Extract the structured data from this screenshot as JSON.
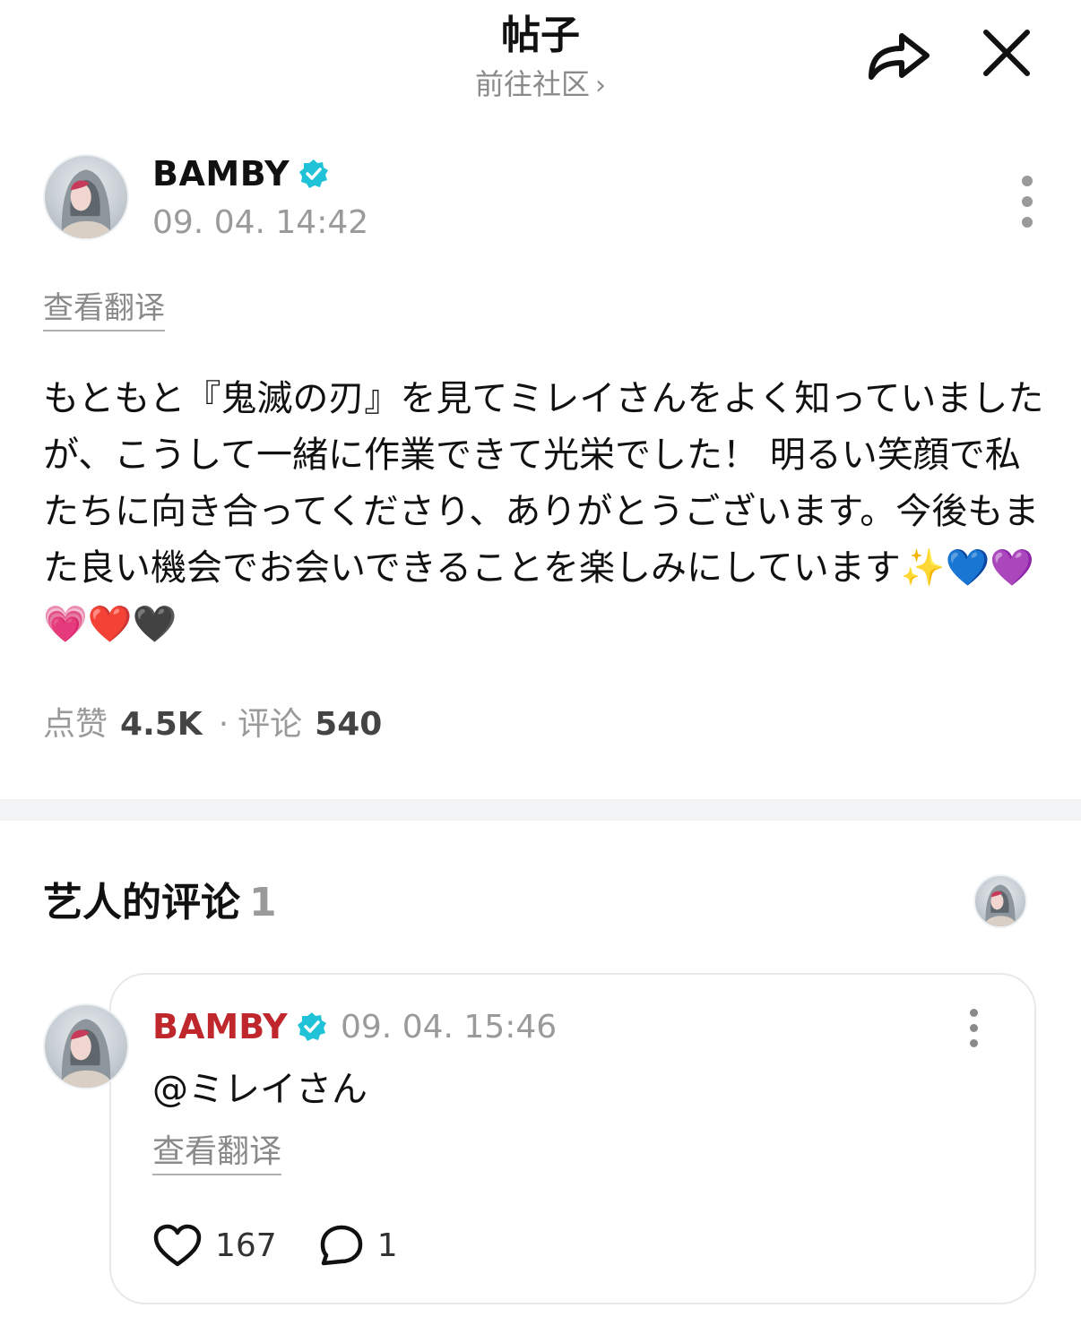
{
  "header": {
    "title": "帖子",
    "community_link": "前往社区",
    "share_icon": "share-icon",
    "close_icon": "close-icon"
  },
  "post": {
    "author": "BAMBY",
    "verified_icon": "verified-badge-icon",
    "timestamp": "09. 04. 14:42",
    "translate_label": "查看翻译",
    "body": "もともと『鬼滅の刃』を見てミレイさんをよく知っていましたが、こうして一緒に作業できて光栄でした！ 明るい笑顔で私たちに向き合ってくださり、ありがとうございます。今後もまた良い機会でお会いできることを楽しみにしています✨💙💜💗❤️🖤",
    "likes_label": "点赞",
    "likes_value": "4.5K",
    "comments_label": "评论",
    "comments_value": "540"
  },
  "artist_comments": {
    "title": "艺人的评论",
    "count": "1",
    "comment": {
      "author": "BAMBY",
      "timestamp": "09. 04. 15:46",
      "text": "@ミレイさん",
      "translate_label": "查看翻译",
      "likes": "167",
      "replies": "1"
    }
  },
  "colors": {
    "accent_red": "#c0272d",
    "verified": "#1fc2d6",
    "muted": "#9a9a9a"
  }
}
